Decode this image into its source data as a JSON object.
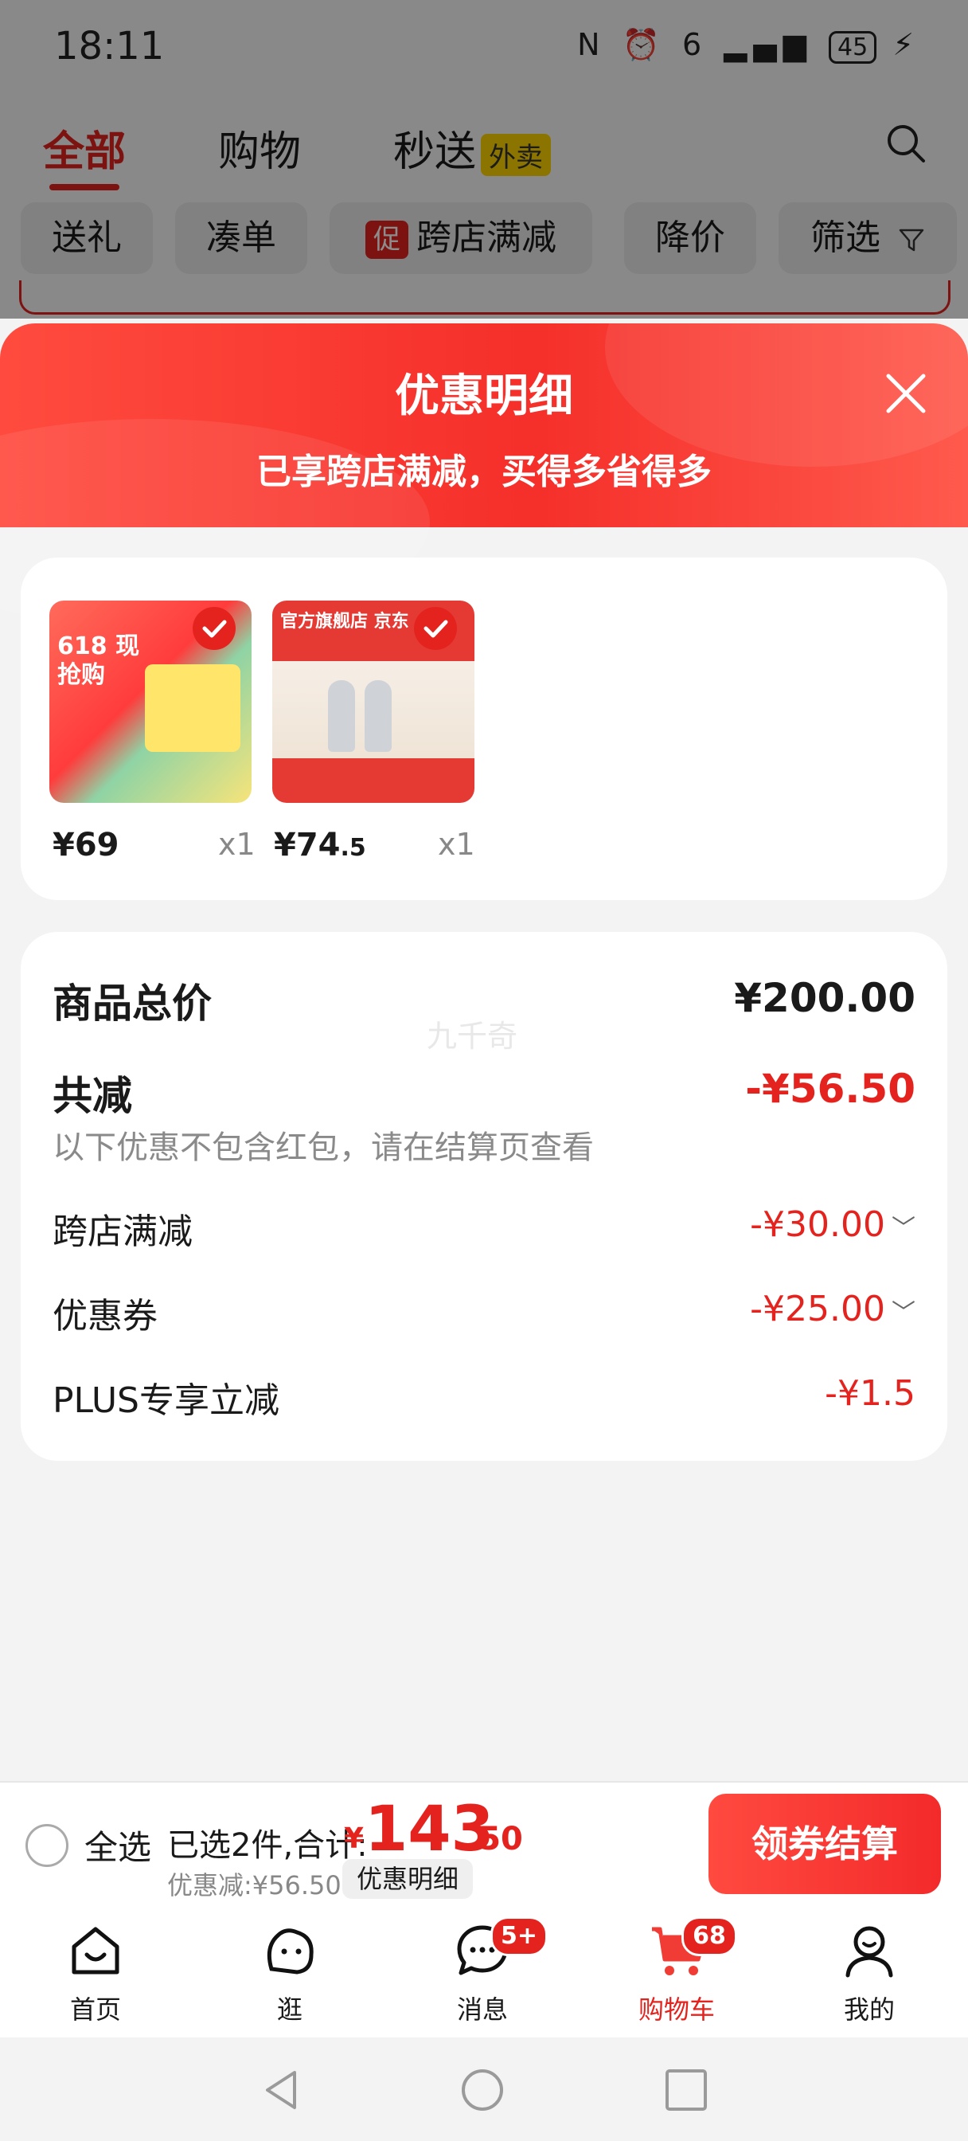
{
  "status_bar": {
    "time": "18:11",
    "battery": "45",
    "icons": "N ⏰ 6 ▂▄▆"
  },
  "background": {
    "tabs": [
      {
        "label": "全部"
      },
      {
        "label": "购物"
      },
      {
        "label": "秒送",
        "tag": "外卖"
      }
    ],
    "chips": [
      {
        "label": "送礼"
      },
      {
        "label": "凑单"
      },
      {
        "label": "跨店满减",
        "tag": "促"
      },
      {
        "label": "降价"
      },
      {
        "label": "筛选"
      }
    ]
  },
  "sheet": {
    "title": "优惠明细",
    "subtitle": "已享跨店满减，买得多省得多"
  },
  "products": [
    {
      "price_main": "¥69",
      "price_cents": "",
      "qty": "x1",
      "image_text": "618 现抢购"
    },
    {
      "price_main": "¥74",
      "price_cents": ".5",
      "qty": "x1",
      "image_text": "官方旗舰店 京东"
    }
  ],
  "summary": {
    "total_label": "商品总价",
    "total_value": "¥200.00",
    "watermark": "九千奇",
    "reduction_label": "共减",
    "reduction_value": "-¥56.50",
    "note": "以下优惠不包含红包，请在结算页查看",
    "items": [
      {
        "label": "跨店满减",
        "value": "-¥30.00"
      },
      {
        "label": "优惠券",
        "value": "-¥25.00"
      },
      {
        "label": "PLUS专享立减",
        "value": "-¥1.5"
      }
    ]
  },
  "checkout": {
    "select_all": "全选",
    "selected_text": "已选2件,合计:",
    "yen": "¥",
    "total_main": "143",
    "total_cents": ".50",
    "discount_text": "优惠减:¥56.50",
    "detail_chip": "优惠明细",
    "button": "领券结算"
  },
  "nav": [
    {
      "label": "首页"
    },
    {
      "label": "逛"
    },
    {
      "label": "消息",
      "badge": "5+"
    },
    {
      "label": "购物车",
      "badge": "68"
    },
    {
      "label": "我的"
    }
  ],
  "colors": {
    "accent": "#e4231e",
    "background": "#f3f3f3"
  }
}
